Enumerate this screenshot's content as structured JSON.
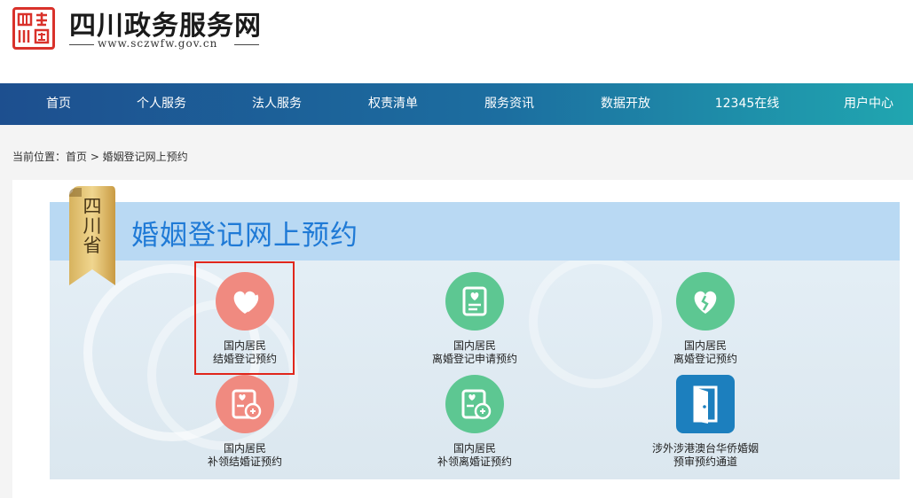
{
  "header": {
    "seal_text": "四川政务",
    "site_title": "四川政务服务网",
    "site_url": "www.sczwfw.gov.cn"
  },
  "nav": {
    "items": [
      {
        "label": "首页"
      },
      {
        "label": "个人服务"
      },
      {
        "label": "法人服务"
      },
      {
        "label": "权责清单"
      },
      {
        "label": "服务资讯"
      },
      {
        "label": "数据开放"
      },
      {
        "label": "12345在线"
      },
      {
        "label": "用户中心"
      }
    ]
  },
  "breadcrumb": {
    "text": "当前位置：首页 > 婚姻登记网上预约"
  },
  "banner": {
    "ribbon_text": "四川省",
    "title": "婚姻登记网上预约"
  },
  "services": [
    {
      "line1": "国内居民",
      "line2": "结婚登记预约",
      "icon": "heart-icon",
      "color": "#f08a80"
    },
    {
      "line1": "国内居民",
      "line2": "离婚登记申请预约",
      "icon": "document-heart-icon",
      "color": "#5dc792"
    },
    {
      "line1": "国内居民",
      "line2": "离婚登记预约",
      "icon": "broken-heart-icon",
      "color": "#5dc792"
    },
    {
      "line1": "国内居民",
      "line2": "补领结婚证预约",
      "icon": "certificate-add-icon",
      "color": "#f08a80"
    },
    {
      "line1": "国内居民",
      "line2": "补领离婚证预约",
      "icon": "certificate-add-icon",
      "color": "#5dc792"
    },
    {
      "line1": "涉外涉港澳台华侨婚姻",
      "line2": "预审预约通道",
      "icon": "door-icon",
      "color": "#1c7fbe"
    }
  ],
  "colors": {
    "nav_start": "#1d4f8f",
    "nav_end": "#20a6b0",
    "title_blue": "#1f7ad6",
    "highlight_red": "#e0261b"
  }
}
